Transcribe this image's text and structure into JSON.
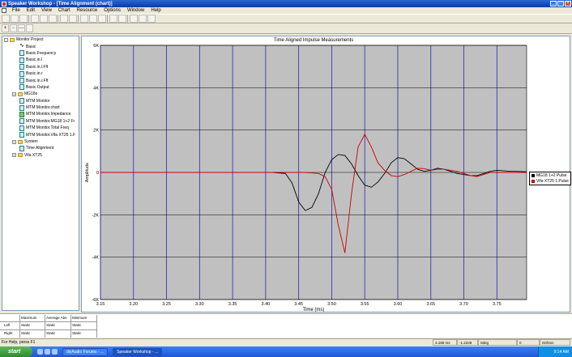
{
  "window": {
    "title": "Speaker Workshop - [Time Alignment (chart)]"
  },
  "menu": [
    "File",
    "Edit",
    "View",
    "Chart",
    "Resource",
    "Options",
    "Window",
    "Help"
  ],
  "toolbar_icons": [
    "new-icon",
    "open-icon",
    "save-icon",
    "",
    "cut-icon",
    "copy-icon",
    "paste-icon",
    "",
    "undo-icon",
    "redo-icon",
    "",
    "chart-icon",
    "properties-icon",
    "print-icon",
    "",
    "zoom-in-icon",
    "zoom-out-icon",
    "",
    "measure-icon",
    "help-icon",
    "about-icon"
  ],
  "tree": [
    {
      "label": "Monitor Project",
      "indent": 0,
      "icon": "folder",
      "expander": "-"
    },
    {
      "label": "Basic",
      "indent": 1,
      "icon": "wave",
      "expander": ""
    },
    {
      "label": "Basic.Frequency",
      "indent": 1,
      "icon": "doc",
      "expander": ""
    },
    {
      "label": "Basic.in.l",
      "indent": 1,
      "icon": "doc",
      "expander": ""
    },
    {
      "label": "Basic.in.l.Fft",
      "indent": 1,
      "icon": "doc",
      "expander": ""
    },
    {
      "label": "Basic.in.r",
      "indent": 1,
      "icon": "doc",
      "expander": ""
    },
    {
      "label": "Basic.in.r.Fft",
      "indent": 1,
      "icon": "doc",
      "expander": ""
    },
    {
      "label": "Basic.Output",
      "indent": 1,
      "icon": "doc",
      "expander": ""
    },
    {
      "label": "MG18s",
      "indent": 1,
      "icon": "folder",
      "expander": "+"
    },
    {
      "label": "MTM Monitor",
      "indent": 1,
      "icon": "doc",
      "expander": ""
    },
    {
      "label": "MTM Monitor.chart",
      "indent": 1,
      "icon": "doc",
      "expander": ""
    },
    {
      "label": "MTM Monitor.Impedance",
      "indent": 1,
      "icon": "green",
      "expander": ""
    },
    {
      "label": "MTM Monitor.MG18 1+2 Fr",
      "indent": 1,
      "icon": "doc",
      "expander": ""
    },
    {
      "label": "MTM Monitor.Total Freq",
      "indent": 1,
      "icon": "doc",
      "expander": ""
    },
    {
      "label": "MTM Monitor.Vifa XT25 1.F",
      "indent": 1,
      "icon": "doc",
      "expander": ""
    },
    {
      "label": "System",
      "indent": 1,
      "icon": "folder",
      "expander": "+"
    },
    {
      "label": "Time Alignment",
      "indent": 1,
      "icon": "doc",
      "expander": ""
    },
    {
      "label": "Vifa XT25",
      "indent": 1,
      "icon": "folder",
      "expander": "+"
    }
  ],
  "chart_data": {
    "type": "line",
    "title": "Time Aligned Impulse Measurements",
    "xlabel": "Time (ms)",
    "ylabel": "Amplitude",
    "xlim": [
      3.15,
      3.795
    ],
    "ylim": [
      -6000,
      6000
    ],
    "x_ticks": [
      "3.15",
      "3.20",
      "3.25",
      "3.30",
      "3.35",
      "3.40",
      "3.45",
      "3.50",
      "3.55",
      "3.60",
      "3.65",
      "3.70",
      "3.75"
    ],
    "y_ticks": [
      "6K",
      "4K",
      "2K",
      "0",
      "-2K",
      "-4K",
      "-6K"
    ],
    "grid": true,
    "legend_position": "right",
    "series": [
      {
        "name": "MG18 1+2 Pulse",
        "color": "#000000",
        "points": [
          [
            3.15,
            0
          ],
          [
            3.41,
            0
          ],
          [
            3.43,
            -50
          ],
          [
            3.44,
            -500
          ],
          [
            3.45,
            -1400
          ],
          [
            3.46,
            -1800
          ],
          [
            3.47,
            -1650
          ],
          [
            3.48,
            -1000
          ],
          [
            3.49,
            0
          ],
          [
            3.5,
            600
          ],
          [
            3.51,
            850
          ],
          [
            3.52,
            800
          ],
          [
            3.53,
            400
          ],
          [
            3.54,
            -150
          ],
          [
            3.55,
            -600
          ],
          [
            3.56,
            -700
          ],
          [
            3.57,
            -450
          ],
          [
            3.58,
            -50
          ],
          [
            3.59,
            450
          ],
          [
            3.6,
            700
          ],
          [
            3.61,
            650
          ],
          [
            3.62,
            400
          ],
          [
            3.63,
            150
          ],
          [
            3.64,
            50
          ],
          [
            3.65,
            100
          ],
          [
            3.66,
            200
          ],
          [
            3.67,
            150
          ],
          [
            3.68,
            50
          ],
          [
            3.69,
            -50
          ],
          [
            3.7,
            -100
          ],
          [
            3.71,
            -150
          ],
          [
            3.72,
            -150
          ],
          [
            3.73,
            -50
          ],
          [
            3.74,
            50
          ],
          [
            3.75,
            100
          ],
          [
            3.76,
            80
          ],
          [
            3.77,
            50
          ],
          [
            3.78,
            50
          ],
          [
            3.795,
            30
          ]
        ]
      },
      {
        "name": "Vifa XT25 1.Pulse",
        "color": "#cc0000",
        "points": [
          [
            3.15,
            0
          ],
          [
            3.46,
            0
          ],
          [
            3.48,
            -50
          ],
          [
            3.49,
            -200
          ],
          [
            3.5,
            -800
          ],
          [
            3.51,
            -2500
          ],
          [
            3.52,
            -3800
          ],
          [
            3.53,
            -1000
          ],
          [
            3.54,
            1200
          ],
          [
            3.55,
            1800
          ],
          [
            3.56,
            1200
          ],
          [
            3.57,
            450
          ],
          [
            3.58,
            100
          ],
          [
            3.59,
            -150
          ],
          [
            3.6,
            -200
          ],
          [
            3.61,
            -100
          ],
          [
            3.62,
            50
          ],
          [
            3.63,
            200
          ],
          [
            3.64,
            180
          ],
          [
            3.65,
            100
          ],
          [
            3.66,
            150
          ],
          [
            3.67,
            150
          ],
          [
            3.68,
            100
          ],
          [
            3.69,
            50
          ],
          [
            3.7,
            -50
          ],
          [
            3.71,
            -150
          ],
          [
            3.72,
            -200
          ],
          [
            3.73,
            -100
          ],
          [
            3.74,
            0
          ],
          [
            3.75,
            0
          ],
          [
            3.76,
            0
          ],
          [
            3.77,
            0
          ],
          [
            3.795,
            0
          ]
        ]
      }
    ]
  },
  "stats": {
    "headers": [
      "Maximum",
      "Average Abs",
      "Minimum"
    ],
    "rows": [
      {
        "label": "Left",
        "values": [
          "Static",
          "Static",
          "Static"
        ]
      },
      {
        "label": "Right",
        "values": [
          "Static",
          "Static",
          "Static"
        ]
      }
    ]
  },
  "status": {
    "help": "For Help, press F1",
    "time": "3.185 ms",
    "value": "-1.2228",
    "deg": "0deg",
    "zero": "0",
    "ohms": "0Ohms"
  },
  "taskbar": {
    "start": "start",
    "tasks": [
      "diyAudio Forums - ...",
      "Speaker Workshop - ..."
    ],
    "clock": "9:14 AM"
  }
}
